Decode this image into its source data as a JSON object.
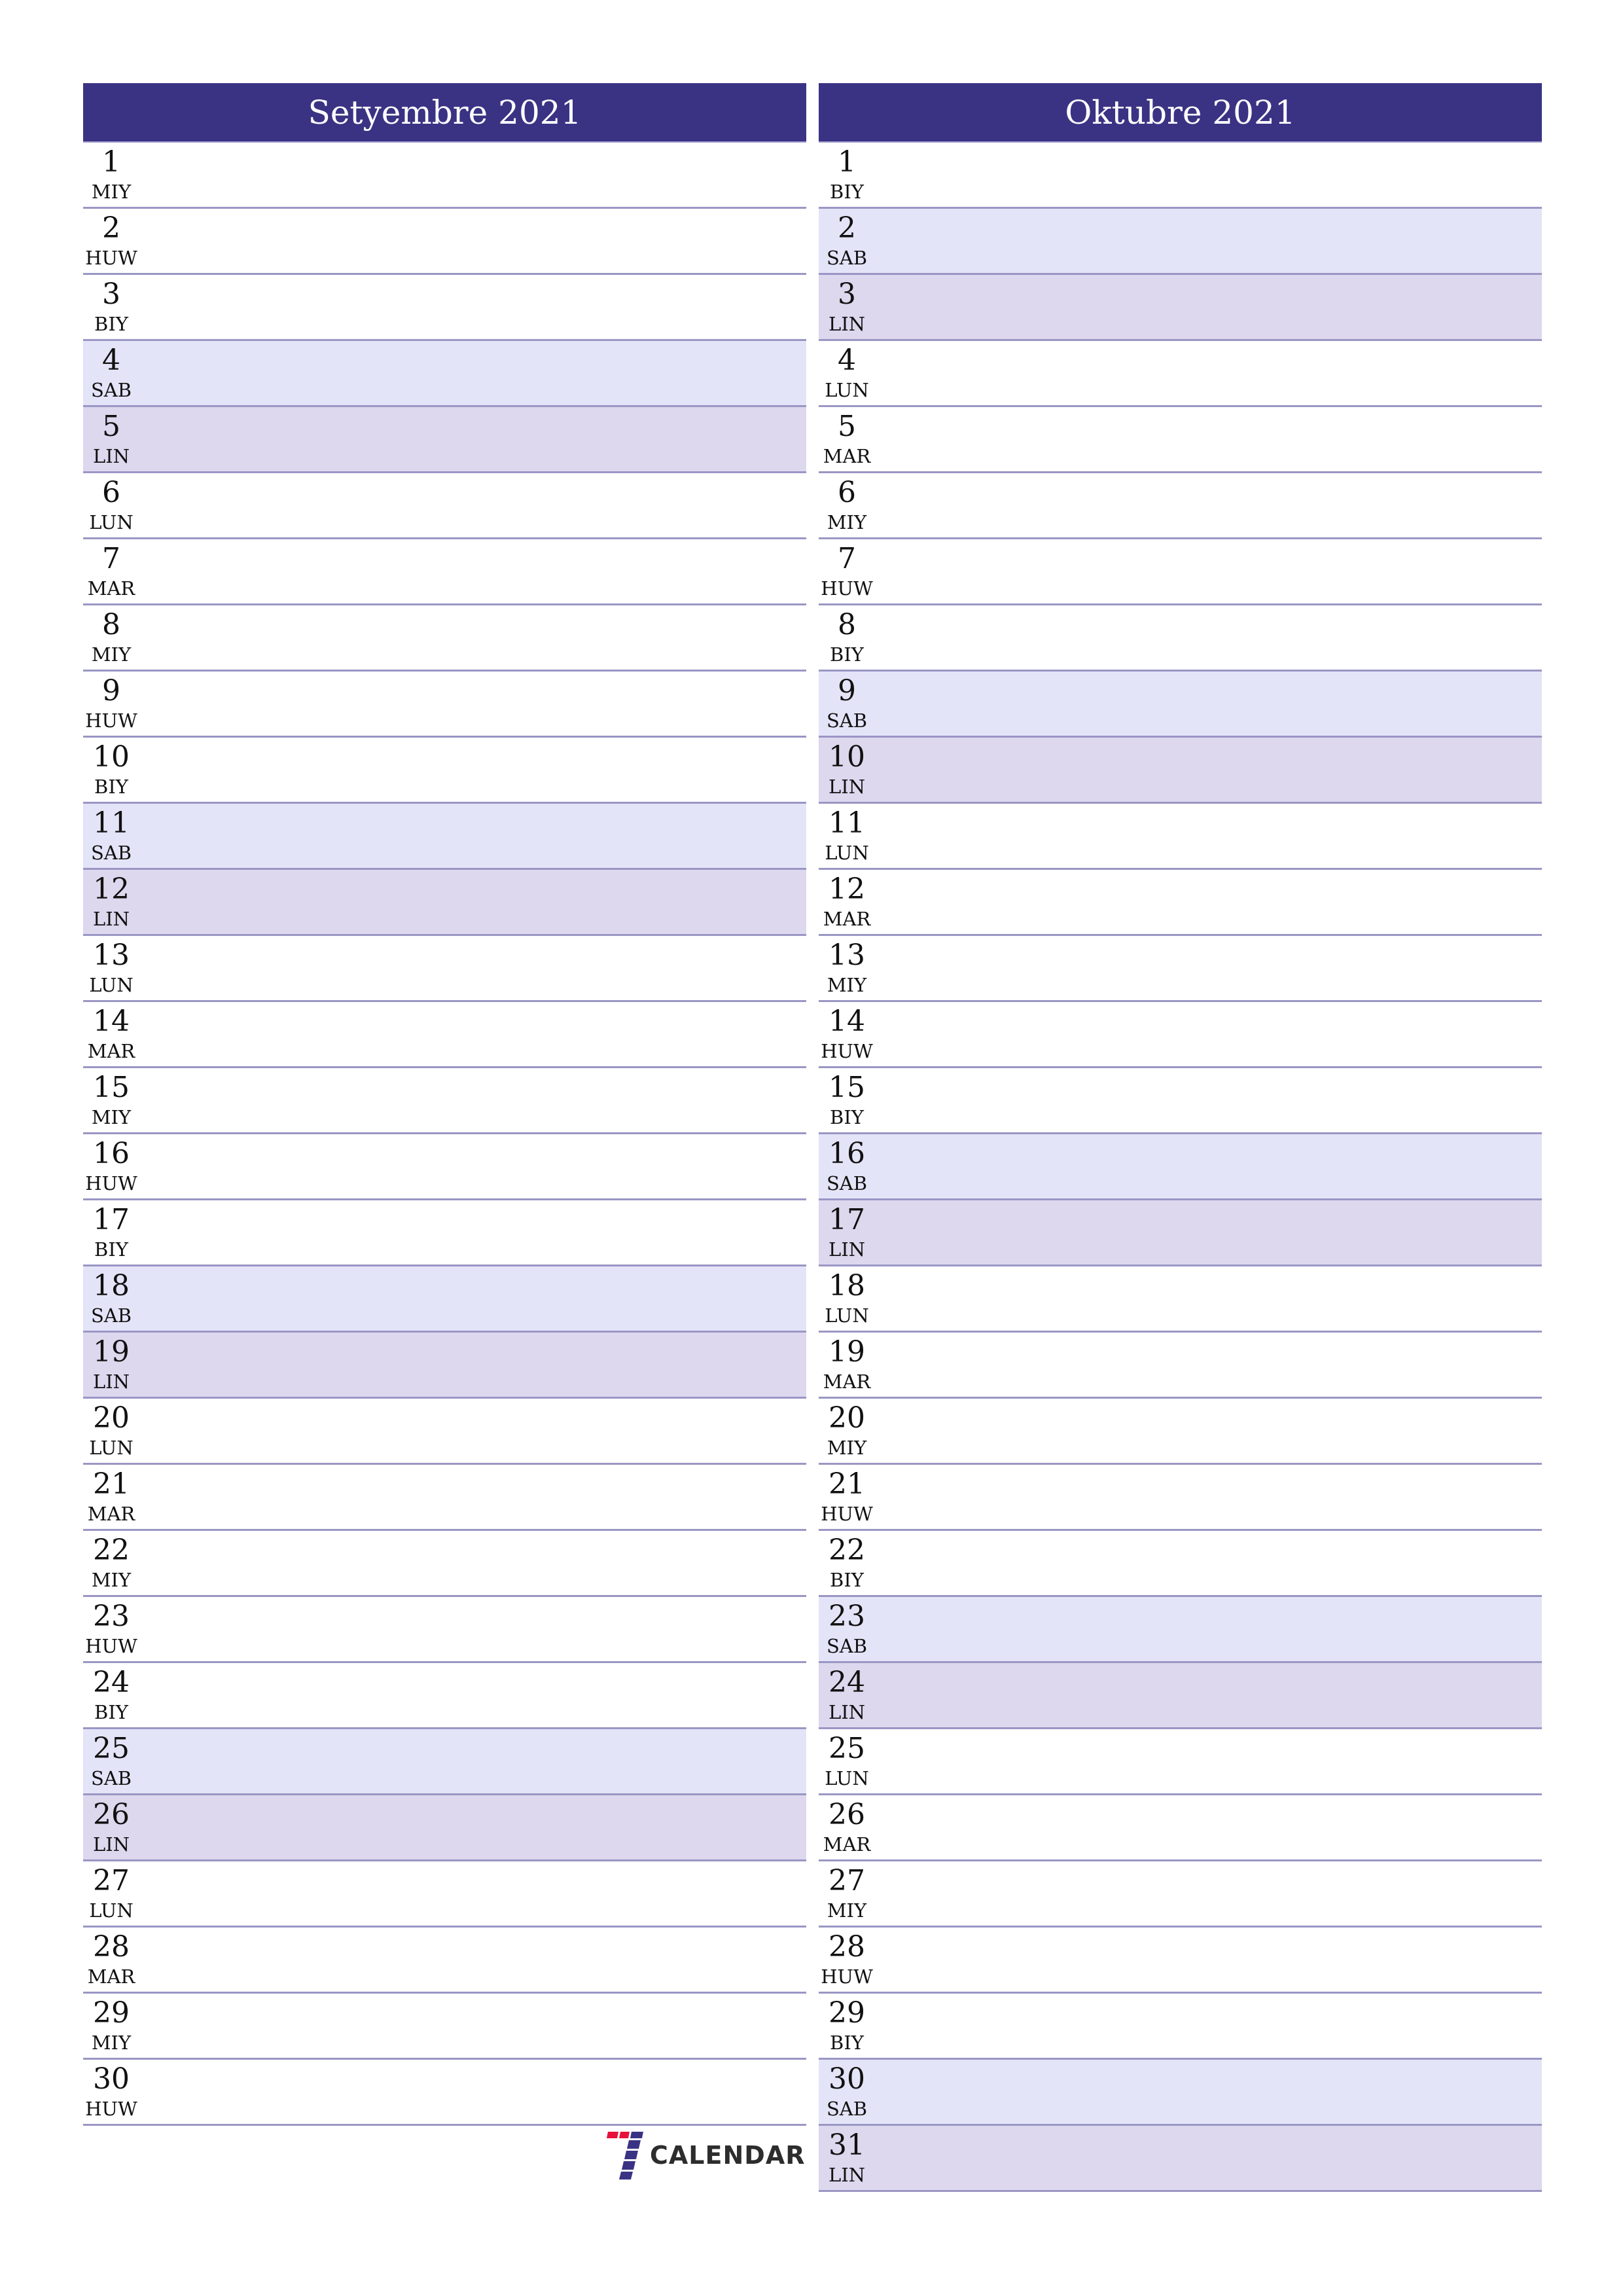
{
  "months": [
    {
      "title": "Setyembre 2021",
      "days": [
        {
          "num": "1",
          "name": "MIY",
          "type": "weekday"
        },
        {
          "num": "2",
          "name": "HUW",
          "type": "weekday"
        },
        {
          "num": "3",
          "name": "BIY",
          "type": "weekday"
        },
        {
          "num": "4",
          "name": "SAB",
          "type": "sat"
        },
        {
          "num": "5",
          "name": "LIN",
          "type": "sun"
        },
        {
          "num": "6",
          "name": "LUN",
          "type": "weekday"
        },
        {
          "num": "7",
          "name": "MAR",
          "type": "weekday"
        },
        {
          "num": "8",
          "name": "MIY",
          "type": "weekday"
        },
        {
          "num": "9",
          "name": "HUW",
          "type": "weekday"
        },
        {
          "num": "10",
          "name": "BIY",
          "type": "weekday"
        },
        {
          "num": "11",
          "name": "SAB",
          "type": "sat"
        },
        {
          "num": "12",
          "name": "LIN",
          "type": "sun"
        },
        {
          "num": "13",
          "name": "LUN",
          "type": "weekday"
        },
        {
          "num": "14",
          "name": "MAR",
          "type": "weekday"
        },
        {
          "num": "15",
          "name": "MIY",
          "type": "weekday"
        },
        {
          "num": "16",
          "name": "HUW",
          "type": "weekday"
        },
        {
          "num": "17",
          "name": "BIY",
          "type": "weekday"
        },
        {
          "num": "18",
          "name": "SAB",
          "type": "sat"
        },
        {
          "num": "19",
          "name": "LIN",
          "type": "sun"
        },
        {
          "num": "20",
          "name": "LUN",
          "type": "weekday"
        },
        {
          "num": "21",
          "name": "MAR",
          "type": "weekday"
        },
        {
          "num": "22",
          "name": "MIY",
          "type": "weekday"
        },
        {
          "num": "23",
          "name": "HUW",
          "type": "weekday"
        },
        {
          "num": "24",
          "name": "BIY",
          "type": "weekday"
        },
        {
          "num": "25",
          "name": "SAB",
          "type": "sat"
        },
        {
          "num": "26",
          "name": "LIN",
          "type": "sun"
        },
        {
          "num": "27",
          "name": "LUN",
          "type": "weekday"
        },
        {
          "num": "28",
          "name": "MAR",
          "type": "weekday"
        },
        {
          "num": "29",
          "name": "MIY",
          "type": "weekday"
        },
        {
          "num": "30",
          "name": "HUW",
          "type": "weekday"
        }
      ]
    },
    {
      "title": "Oktubre 2021",
      "days": [
        {
          "num": "1",
          "name": "BIY",
          "type": "weekday"
        },
        {
          "num": "2",
          "name": "SAB",
          "type": "sat"
        },
        {
          "num": "3",
          "name": "LIN",
          "type": "sun"
        },
        {
          "num": "4",
          "name": "LUN",
          "type": "weekday"
        },
        {
          "num": "5",
          "name": "MAR",
          "type": "weekday"
        },
        {
          "num": "6",
          "name": "MIY",
          "type": "weekday"
        },
        {
          "num": "7",
          "name": "HUW",
          "type": "weekday"
        },
        {
          "num": "8",
          "name": "BIY",
          "type": "weekday"
        },
        {
          "num": "9",
          "name": "SAB",
          "type": "sat"
        },
        {
          "num": "10",
          "name": "LIN",
          "type": "sun"
        },
        {
          "num": "11",
          "name": "LUN",
          "type": "weekday"
        },
        {
          "num": "12",
          "name": "MAR",
          "type": "weekday"
        },
        {
          "num": "13",
          "name": "MIY",
          "type": "weekday"
        },
        {
          "num": "14",
          "name": "HUW",
          "type": "weekday"
        },
        {
          "num": "15",
          "name": "BIY",
          "type": "weekday"
        },
        {
          "num": "16",
          "name": "SAB",
          "type": "sat"
        },
        {
          "num": "17",
          "name": "LIN",
          "type": "sun"
        },
        {
          "num": "18",
          "name": "LUN",
          "type": "weekday"
        },
        {
          "num": "19",
          "name": "MAR",
          "type": "weekday"
        },
        {
          "num": "20",
          "name": "MIY",
          "type": "weekday"
        },
        {
          "num": "21",
          "name": "HUW",
          "type": "weekday"
        },
        {
          "num": "22",
          "name": "BIY",
          "type": "weekday"
        },
        {
          "num": "23",
          "name": "SAB",
          "type": "sat"
        },
        {
          "num": "24",
          "name": "LIN",
          "type": "sun"
        },
        {
          "num": "25",
          "name": "LUN",
          "type": "weekday"
        },
        {
          "num": "26",
          "name": "MAR",
          "type": "weekday"
        },
        {
          "num": "27",
          "name": "MIY",
          "type": "weekday"
        },
        {
          "num": "28",
          "name": "HUW",
          "type": "weekday"
        },
        {
          "num": "29",
          "name": "BIY",
          "type": "weekday"
        },
        {
          "num": "30",
          "name": "SAB",
          "type": "sat"
        },
        {
          "num": "31",
          "name": "LIN",
          "type": "sun"
        }
      ]
    }
  ],
  "logo": {
    "text": "CALENDAR",
    "icon": "seven-logo-icon"
  },
  "colors": {
    "header_bg": "#3a3384",
    "header_text": "#ffffff",
    "saturday_bg": "#e4e4f8",
    "sunday_bg": "#ddd8ee",
    "divider": "#9a96c4",
    "logo_red": "#e8113a",
    "logo_blue": "#3a3384"
  }
}
